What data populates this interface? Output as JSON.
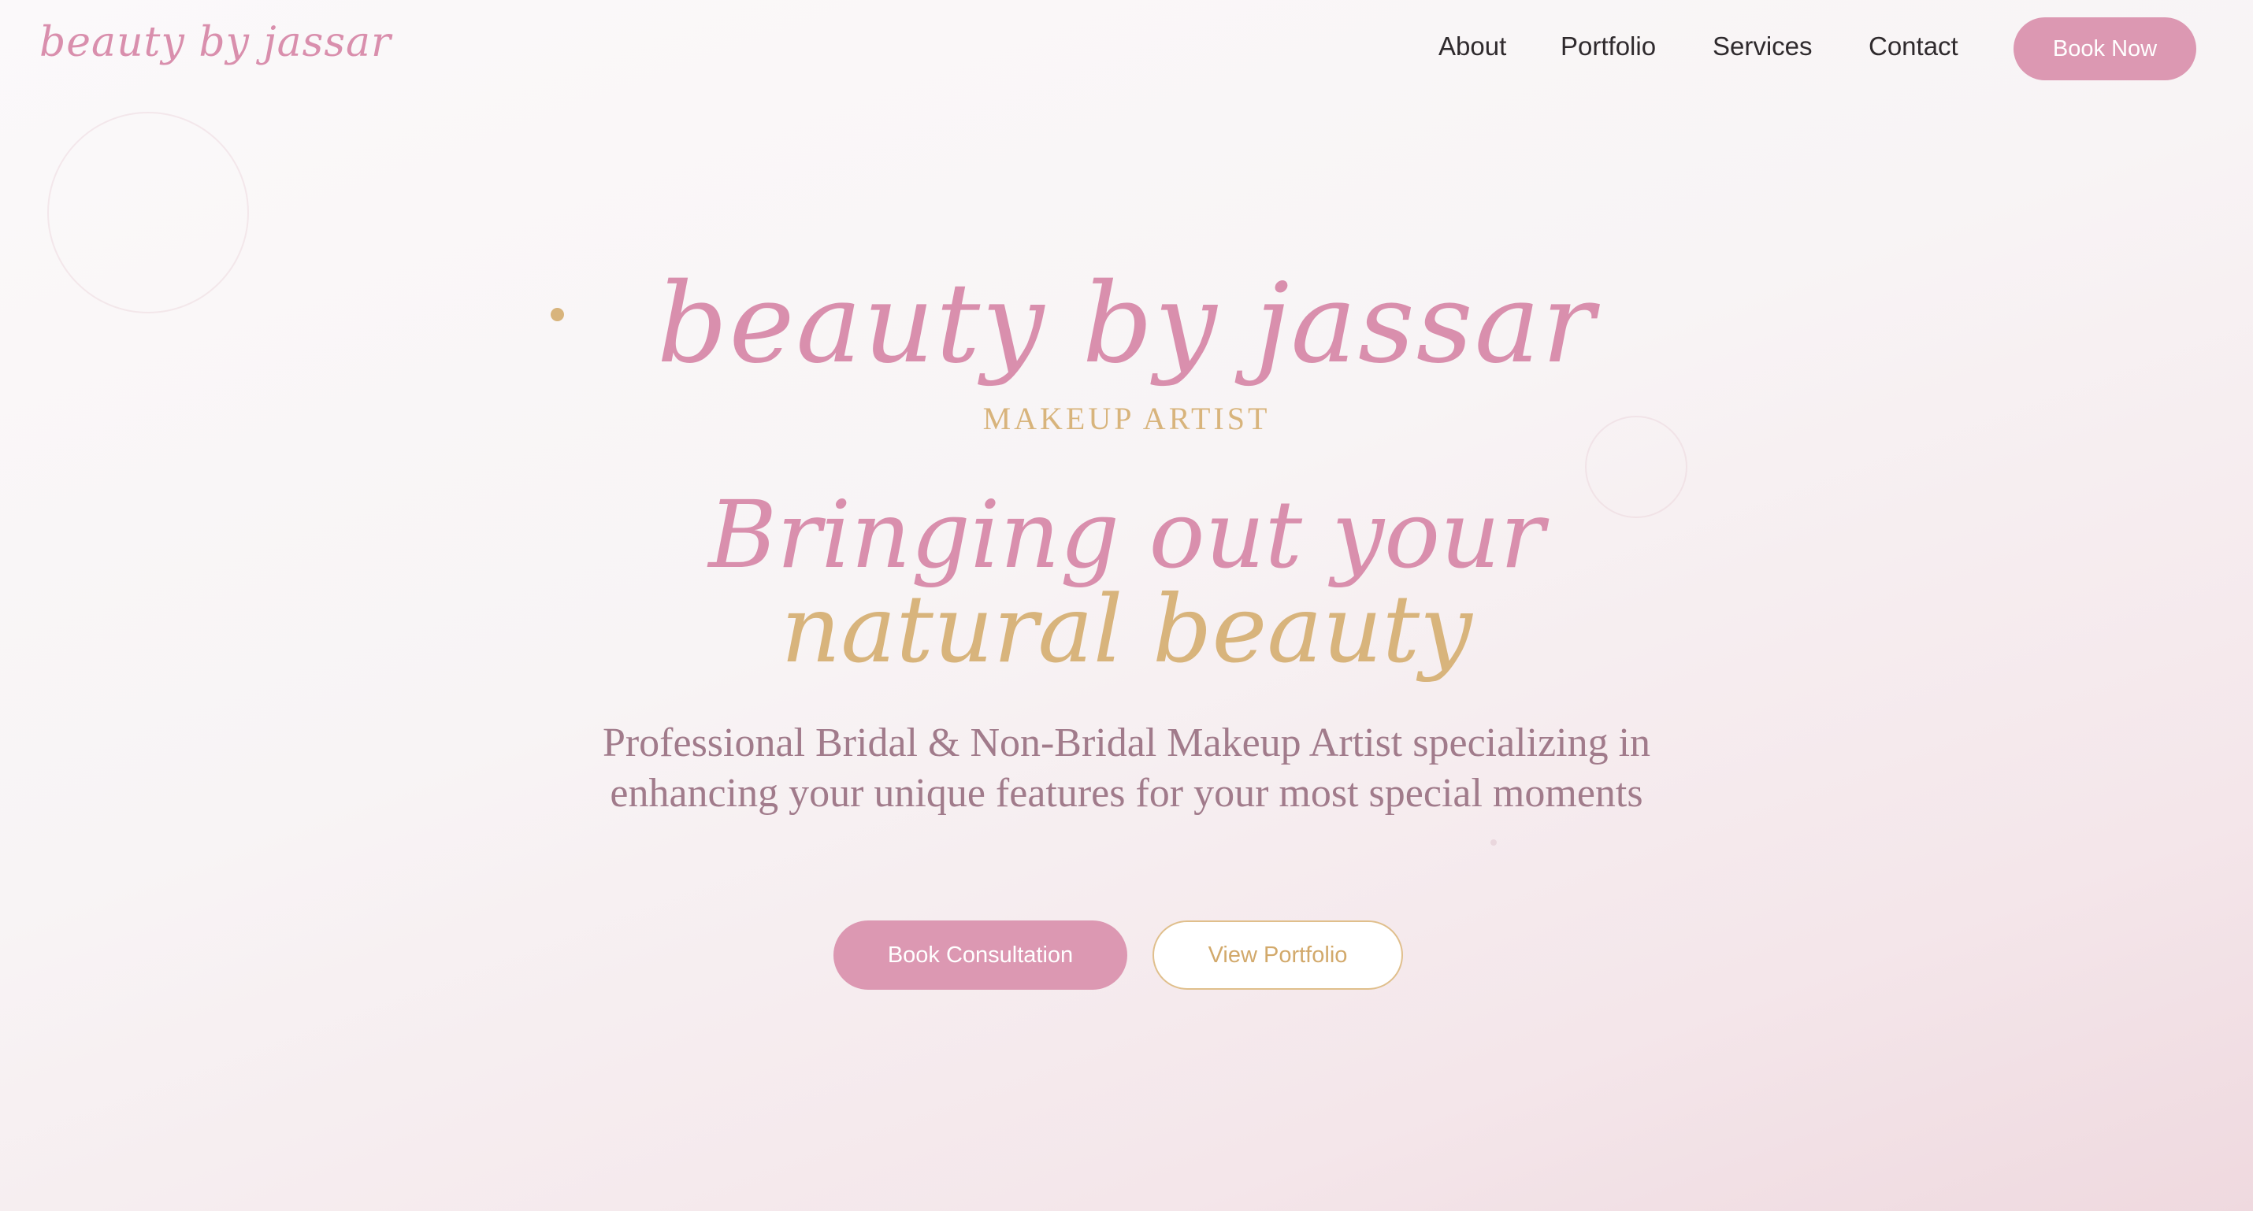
{
  "nav": {
    "logo": "beauty by jassar",
    "links": [
      "About",
      "Portfolio",
      "Services",
      "Contact"
    ],
    "cta": "Book Now"
  },
  "hero": {
    "brand": "beauty by jassar",
    "subtitle": "MAKEUP ARTIST",
    "headline_line1": "Bringing out your",
    "headline_line2": "natural beauty",
    "description": "Professional Bridal & Non-Bridal Makeup Artist specializing in enhancing your unique features for your most special moments",
    "primary_button": "Book Consultation",
    "secondary_button": "View Portfolio"
  },
  "colors": {
    "accent_pink": "#dc98b2",
    "accent_gold": "#d8b47c",
    "text_dark": "#2f2a2d",
    "text_muted": "#a17b8b"
  }
}
